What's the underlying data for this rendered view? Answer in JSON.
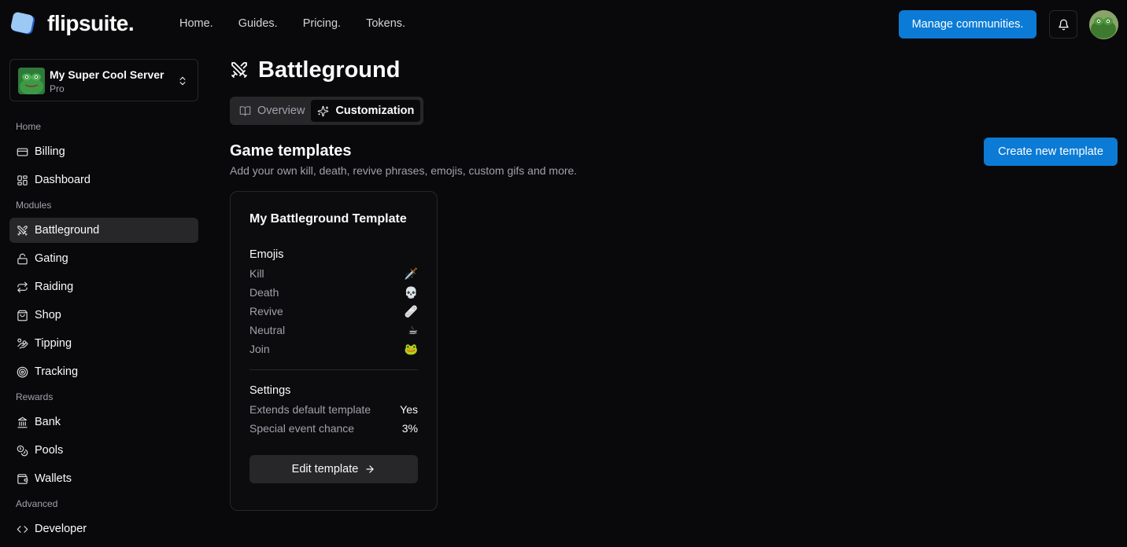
{
  "app": {
    "brand": "flipsuite.",
    "nav": [
      "Home.",
      "Guides.",
      "Pricing.",
      "Tokens."
    ],
    "manage_label": "Manage communities.",
    "accent": "#0b7bd6"
  },
  "server": {
    "name": "My Super Cool Server",
    "plan": "Pro"
  },
  "sidebar": {
    "sections": {
      "home": "Home",
      "modules": "Modules",
      "rewards": "Rewards",
      "advanced": "Advanced"
    },
    "items": {
      "billing": "Billing",
      "dashboard": "Dashboard",
      "battleground": "Battleground",
      "gating": "Gating",
      "raiding": "Raiding",
      "shop": "Shop",
      "tipping": "Tipping",
      "tracking": "Tracking",
      "bank": "Bank",
      "pools": "Pools",
      "wallets": "Wallets",
      "developer": "Developer"
    },
    "active": "battleground"
  },
  "page": {
    "title": "Battleground",
    "tabs": {
      "overview": "Overview",
      "customization": "Customization"
    },
    "active_tab": "customization"
  },
  "templates": {
    "title": "Game templates",
    "subtitle": "Add your own kill, death, revive phrases, emojis, custom gifs and more.",
    "create_label": "Create new template"
  },
  "card": {
    "title": "My Battleground Template",
    "emojis_title": "Emojis",
    "emojis": [
      {
        "label": "Kill",
        "icon": "dagger-icon",
        "value": "🗡️"
      },
      {
        "label": "Death",
        "icon": "skull-icon",
        "value": "💀"
      },
      {
        "label": "Revive",
        "icon": "bandage-icon",
        "value": "🩹"
      },
      {
        "label": "Neutral",
        "icon": "coffee-icon",
        "value": "☕"
      },
      {
        "label": "Join",
        "icon": "frog-icon",
        "value": "🐸"
      }
    ],
    "settings_title": "Settings",
    "settings": [
      {
        "label": "Extends default template",
        "value": "Yes"
      },
      {
        "label": "Special event chance",
        "value": "3%"
      }
    ],
    "edit_label": "Edit template"
  }
}
